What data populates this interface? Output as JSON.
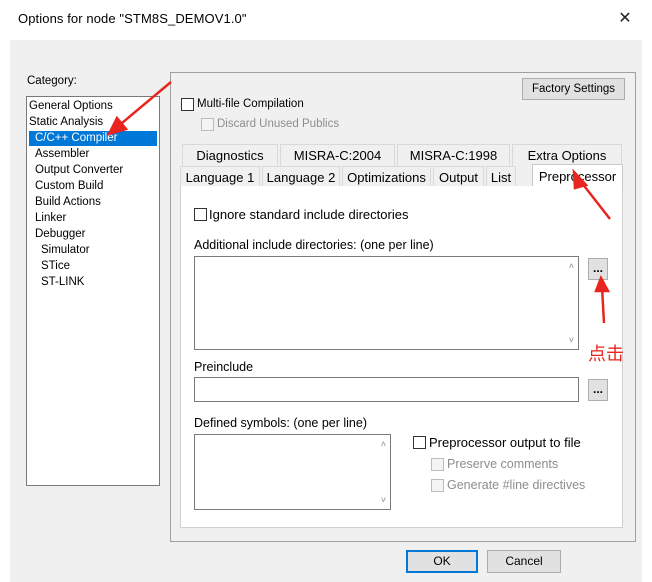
{
  "window": {
    "title": "Options for node \"STM8S_DEMOV1.0\"",
    "close_glyph": "✕"
  },
  "category": {
    "label": "Category:",
    "items": [
      {
        "label": "General Options",
        "indent": 0
      },
      {
        "label": "Static Analysis",
        "indent": 0
      },
      {
        "label": "C/C++ Compiler",
        "indent": 1,
        "selected": true
      },
      {
        "label": "Assembler",
        "indent": 1
      },
      {
        "label": "Output Converter",
        "indent": 1
      },
      {
        "label": "Custom Build",
        "indent": 1
      },
      {
        "label": "Build Actions",
        "indent": 1
      },
      {
        "label": "Linker",
        "indent": 1
      },
      {
        "label": "Debugger",
        "indent": 1
      },
      {
        "label": "Simulator",
        "indent": 2
      },
      {
        "label": "STice",
        "indent": 2
      },
      {
        "label": "ST-LINK",
        "indent": 2
      }
    ]
  },
  "factory_settings": "Factory Settings",
  "multifile": {
    "label": "Multi-file Compilation",
    "discard_label": "Discard Unused Publics"
  },
  "tabs_row1": [
    "Diagnostics",
    "MISRA-C:2004",
    "MISRA-C:1998",
    "Extra Options"
  ],
  "tabs_row2": [
    "Language 1",
    "Language 2",
    "Optimizations",
    "Output",
    "List",
    "Preprocessor"
  ],
  "preprocessor": {
    "ignore_std_label": "Ignore standard include directories",
    "additional_label": "Additional include directories: (one per line)",
    "additional_value": "",
    "browse_label": "...",
    "preinclude_label": "Preinclude",
    "preinclude_value": "",
    "defined_label": "Defined symbols: (one per line)",
    "defined_value": "",
    "pp_output_label": "Preprocessor output to file",
    "preserve_comments_label": "Preserve comments",
    "generate_line_label": "Generate #line directives"
  },
  "annotation": {
    "text": "点击",
    "color": "#e8251e"
  },
  "buttons": {
    "ok": "OK",
    "cancel": "Cancel"
  }
}
